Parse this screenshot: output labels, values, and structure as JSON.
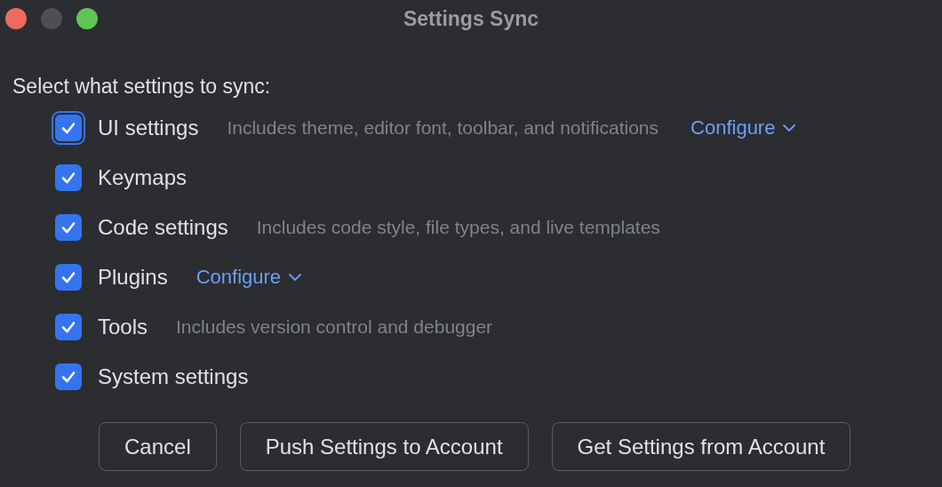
{
  "window": {
    "title": "Settings Sync"
  },
  "prompt": "Select what settings to sync:",
  "options": [
    {
      "label": "UI settings",
      "checked": true,
      "focused": true,
      "description": "Includes theme, editor font, toolbar, and notifications",
      "configure": "Configure"
    },
    {
      "label": "Keymaps",
      "checked": true,
      "focused": false
    },
    {
      "label": "Code settings",
      "checked": true,
      "focused": false,
      "description": "Includes code style, file types, and live templates"
    },
    {
      "label": "Plugins",
      "checked": true,
      "focused": false,
      "configure": "Configure"
    },
    {
      "label": "Tools",
      "checked": true,
      "focused": false,
      "description": "Includes version control and debugger"
    },
    {
      "label": "System settings",
      "checked": true,
      "focused": false
    }
  ],
  "buttons": [
    "Cancel",
    "Push Settings to Account",
    "Get Settings from Account"
  ]
}
